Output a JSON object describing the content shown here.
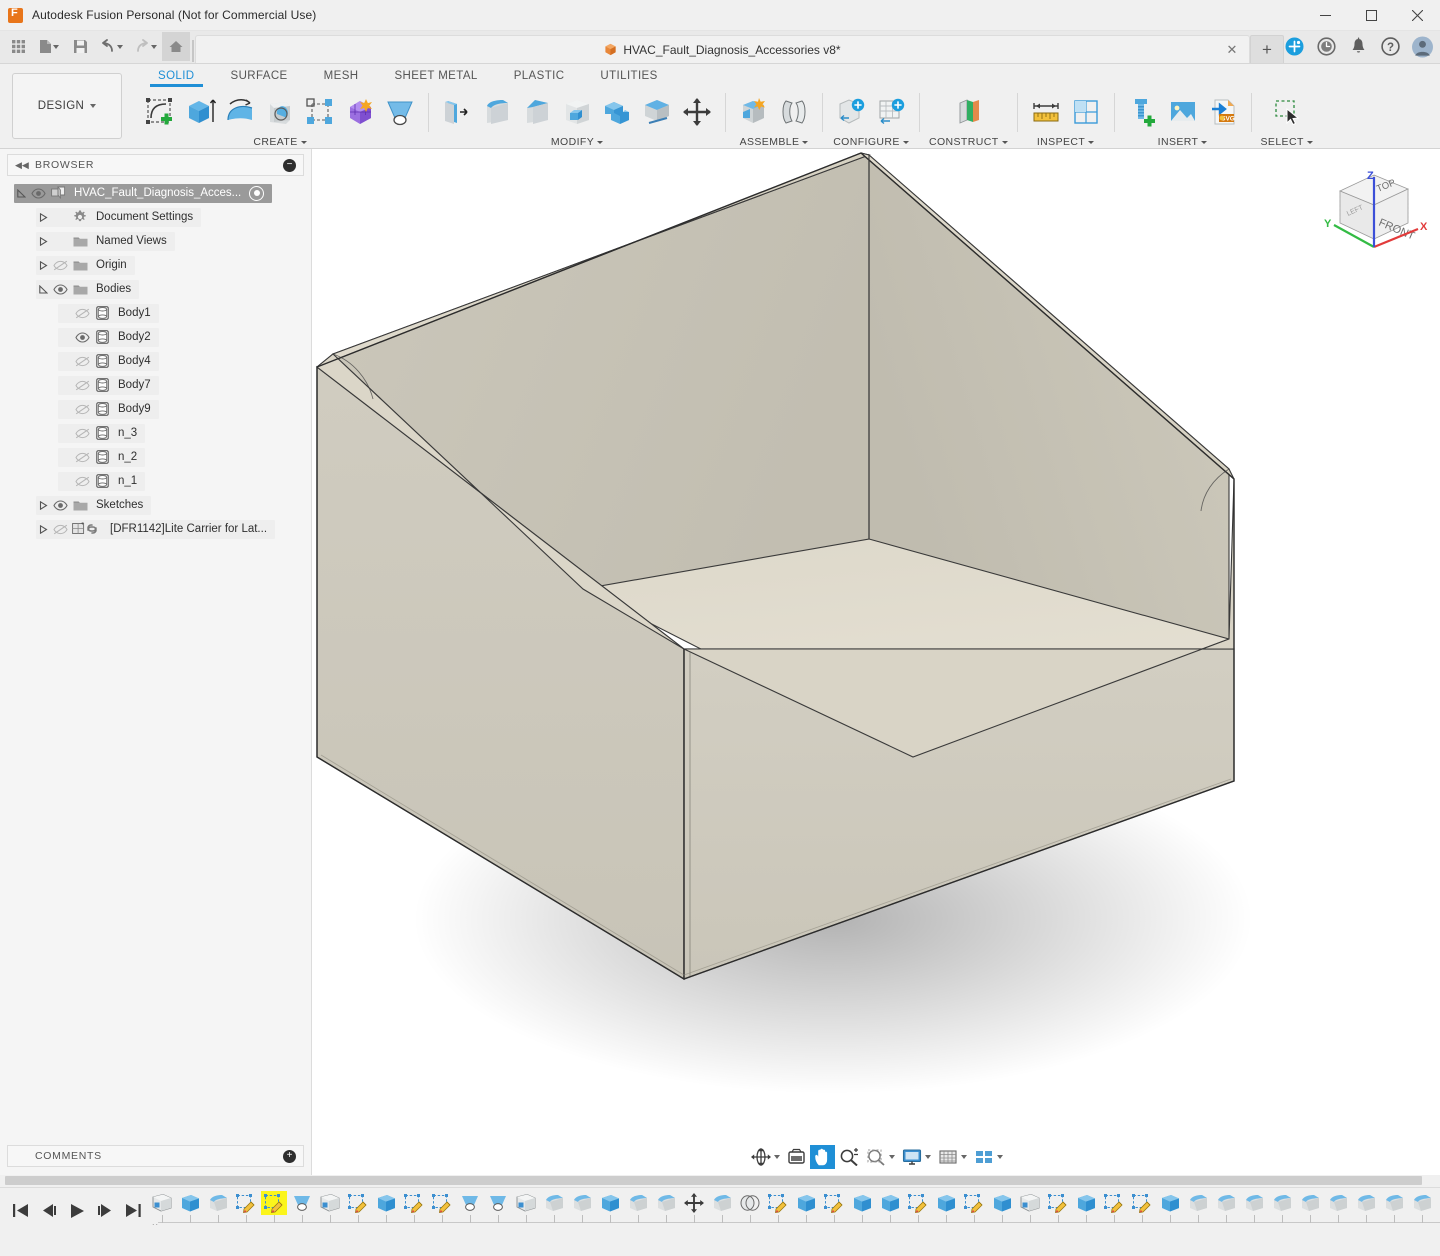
{
  "window": {
    "app_title": "Autodesk Fusion Personal (Not for Commercial Use)",
    "app_icon": "fusion-logo-icon",
    "minimize": "—",
    "maximize": "☐",
    "close": "✕"
  },
  "quick_access": {
    "items": [
      {
        "name": "app-grid-button",
        "icon": "grid-icon",
        "caret": false
      },
      {
        "name": "new-file-button",
        "icon": "file-icon",
        "caret": true
      },
      {
        "name": "save-button",
        "icon": "save-icon",
        "caret": false
      },
      {
        "name": "undo-button",
        "icon": "undo-arrow-icon",
        "caret": true
      },
      {
        "name": "redo-button",
        "icon": "redo-arrow-icon",
        "caret": true
      },
      {
        "name": "home-button",
        "icon": "home-icon",
        "caret": false
      }
    ]
  },
  "document_tab": {
    "label": "HVAC_Fault_Diagnosis_Accessories v8*",
    "icon": "orange-cube-icon",
    "close_label": "✕",
    "new_tab_label": "+"
  },
  "tab_right_icons": [
    {
      "name": "extensions-icon",
      "glyph": "+"
    },
    {
      "name": "job-status-clock-icon",
      "glyph": "○"
    },
    {
      "name": "notifications-bell-icon",
      "glyph": "🔔"
    },
    {
      "name": "help-question-icon",
      "glyph": "?"
    },
    {
      "name": "user-avatar",
      "glyph": ""
    }
  ],
  "ribbon": {
    "workspace_label": "DESIGN",
    "tabs": [
      {
        "label": "SOLID",
        "active": true
      },
      {
        "label": "SURFACE",
        "active": false
      },
      {
        "label": "MESH",
        "active": false
      },
      {
        "label": "SHEET METAL",
        "active": false
      },
      {
        "label": "PLASTIC",
        "active": false
      },
      {
        "label": "UTILITIES",
        "active": false
      }
    ],
    "panels": [
      {
        "title": "CREATE",
        "has_caret": true,
        "buttons": [
          {
            "name": "create-sketch-button",
            "icon": "new-sketch-icon"
          },
          {
            "name": "extrude-button",
            "icon": "extrude-icon"
          },
          {
            "name": "revolve-button",
            "icon": "revolve-icon"
          },
          {
            "name": "sweep-button",
            "icon": "sweep-icon"
          },
          {
            "name": "pattern-button",
            "icon": "rectangular-pattern-icon"
          },
          {
            "name": "create-form-button",
            "icon": "form-sculpt-icon"
          },
          {
            "name": "loft-button",
            "icon": "loft-icon"
          }
        ]
      },
      {
        "title": "MODIFY",
        "has_caret": true,
        "buttons": [
          {
            "name": "press-pull-button",
            "icon": "press-pull-icon"
          },
          {
            "name": "fillet-button",
            "icon": "fillet-icon"
          },
          {
            "name": "chamfer-button",
            "icon": "chamfer-icon"
          },
          {
            "name": "shell-button",
            "icon": "shell-icon"
          },
          {
            "name": "combine-button",
            "icon": "combine-icon"
          },
          {
            "name": "split-face-button",
            "icon": "split-body-icon"
          },
          {
            "name": "move-copy-button",
            "icon": "move-copy-arrows-icon"
          }
        ]
      },
      {
        "title": "ASSEMBLE",
        "has_caret": true,
        "buttons": [
          {
            "name": "new-component-button",
            "icon": "new-component-icon"
          },
          {
            "name": "joint-button",
            "icon": "joint-icon"
          }
        ]
      },
      {
        "title": "CONFIGURE",
        "has_caret": true,
        "buttons": [
          {
            "name": "configuration-button",
            "icon": "configure-part-icon"
          },
          {
            "name": "configuration-table-button",
            "icon": "configure-table-icon"
          }
        ]
      },
      {
        "title": "CONSTRUCT",
        "has_caret": true,
        "buttons": [
          {
            "name": "offset-plane-button",
            "icon": "construction-plane-icon"
          }
        ]
      },
      {
        "title": "INSPECT",
        "has_caret": true,
        "buttons": [
          {
            "name": "measure-button",
            "icon": "ruler-measure-icon"
          },
          {
            "name": "section-analysis-button",
            "icon": "section-analysis-icon"
          }
        ]
      },
      {
        "title": "INSERT",
        "has_caret": true,
        "buttons": [
          {
            "name": "insert-mcmaster-button",
            "icon": "bolt-insert-icon"
          },
          {
            "name": "canvas-insert-button",
            "icon": "picture-insert-icon"
          },
          {
            "name": "insert-svg-button",
            "icon": "svg-insert-icon"
          }
        ]
      },
      {
        "title": "SELECT",
        "has_caret": true,
        "buttons": [
          {
            "name": "select-tool-button",
            "icon": "selection-cursor-icon"
          }
        ]
      }
    ]
  },
  "browser": {
    "header": "BROWSER",
    "collapse_icon": "collapse-left-arrows-icon",
    "minus_icon": "minus-circle-icon",
    "nodes": [
      {
        "label": "HVAC_Fault_Diagnosis_Acces...",
        "indent": 0,
        "triangle": "expanded",
        "eye": "visible",
        "icon": "component-icon",
        "selected": true,
        "radio": true
      },
      {
        "label": "Document Settings",
        "indent": 1,
        "triangle": "collapsed",
        "eye": "none",
        "icon": "gear-icon",
        "selected": false,
        "radio": false
      },
      {
        "label": "Named Views",
        "indent": 1,
        "triangle": "collapsed",
        "eye": "none",
        "icon": "folder-icon",
        "selected": false,
        "radio": false
      },
      {
        "label": "Origin",
        "indent": 1,
        "triangle": "collapsed",
        "eye": "hidden",
        "icon": "folder-icon",
        "selected": false,
        "radio": false
      },
      {
        "label": "Bodies",
        "indent": 1,
        "triangle": "expanded",
        "eye": "visible",
        "icon": "folder-icon",
        "selected": false,
        "radio": false
      },
      {
        "label": "Body1",
        "indent": 2,
        "triangle": "none",
        "eye": "hidden",
        "icon": "body-icon",
        "selected": false,
        "radio": false
      },
      {
        "label": "Body2",
        "indent": 2,
        "triangle": "none",
        "eye": "visible",
        "icon": "body-icon",
        "selected": false,
        "radio": false
      },
      {
        "label": "Body4",
        "indent": 2,
        "triangle": "none",
        "eye": "hidden",
        "icon": "body-icon",
        "selected": false,
        "radio": false
      },
      {
        "label": "Body7",
        "indent": 2,
        "triangle": "none",
        "eye": "hidden",
        "icon": "body-icon",
        "selected": false,
        "radio": false
      },
      {
        "label": "Body9",
        "indent": 2,
        "triangle": "none",
        "eye": "hidden",
        "icon": "body-icon",
        "selected": false,
        "radio": false
      },
      {
        "label": "n_3",
        "indent": 2,
        "triangle": "none",
        "eye": "hidden",
        "icon": "body-icon",
        "selected": false,
        "radio": false
      },
      {
        "label": "n_2",
        "indent": 2,
        "triangle": "none",
        "eye": "hidden",
        "icon": "body-icon",
        "selected": false,
        "radio": false
      },
      {
        "label": "n_1",
        "indent": 2,
        "triangle": "none",
        "eye": "hidden",
        "icon": "body-icon",
        "selected": false,
        "radio": false
      },
      {
        "label": "Sketches",
        "indent": 1,
        "triangle": "collapsed",
        "eye": "visible",
        "icon": "folder-icon",
        "selected": false,
        "radio": false
      },
      {
        "label": "[DFR1142]Lite Carrier for Lat...",
        "indent": 1,
        "triangle": "collapsed",
        "eye": "hidden",
        "icon": "linked-component-icon",
        "selected": false,
        "radio": false
      }
    ]
  },
  "comments": {
    "header": "COMMENTS",
    "add_icon": "plus-circle-icon"
  },
  "viewcube": {
    "top_label": "TOP",
    "front_label": "FRONT",
    "left_label": "LEFT",
    "axis_x": "X",
    "axis_y": "Y",
    "axis_z": "Z",
    "color_x": "#e23b3b",
    "color_y": "#33bb44",
    "color_z": "#3c4fd8"
  },
  "navigation_bar": {
    "items": [
      {
        "name": "orbit-button",
        "icon": "orbit-icon",
        "caret": true,
        "active": false
      },
      {
        "name": "look-at-button",
        "icon": "look-at-icon",
        "caret": false,
        "active": false
      },
      {
        "name": "pan-button",
        "icon": "pan-hand-icon",
        "caret": false,
        "active": true
      },
      {
        "name": "zoom-button",
        "icon": "zoom-magnifier-icon",
        "caret": false,
        "active": false
      },
      {
        "name": "fit-button",
        "icon": "zoom-fit-icon",
        "caret": true,
        "active": false
      },
      {
        "name": "display-settings-button",
        "icon": "monitor-display-icon",
        "caret": true,
        "active": false
      },
      {
        "name": "grid-snaps-button",
        "icon": "grid-snap-icon",
        "caret": true,
        "active": false
      },
      {
        "name": "viewports-button",
        "icon": "viewport-layout-icon",
        "caret": true,
        "active": false
      }
    ]
  },
  "timeline": {
    "playback": [
      {
        "name": "timeline-go-start-button",
        "icon": "skip-to-start-icon"
      },
      {
        "name": "timeline-step-back-button",
        "icon": "step-back-icon"
      },
      {
        "name": "timeline-play-button",
        "icon": "play-icon"
      },
      {
        "name": "timeline-step-forward-button",
        "icon": "step-forward-icon"
      },
      {
        "name": "timeline-go-end-button",
        "icon": "skip-to-end-icon"
      }
    ],
    "settings_icon": "gear-icon",
    "playhead_icon": "timeline-marker-icon",
    "features": [
      {
        "icon": "sketch-plane-icon",
        "highlight": false
      },
      {
        "icon": "extrude-icon",
        "highlight": false
      },
      {
        "icon": "fillet-icon",
        "highlight": false
      },
      {
        "icon": "sketch-edit-icon",
        "highlight": false
      },
      {
        "icon": "sketch-edit-icon",
        "highlight": true
      },
      {
        "icon": "revolve-icon",
        "highlight": false
      },
      {
        "icon": "sketch-plane-icon",
        "highlight": false
      },
      {
        "icon": "sketch-edit-icon",
        "highlight": false
      },
      {
        "icon": "extrude-icon",
        "highlight": false
      },
      {
        "icon": "sketch-edit-icon",
        "highlight": false
      },
      {
        "icon": "sketch-edit-icon",
        "highlight": false
      },
      {
        "icon": "revolve-icon",
        "highlight": false
      },
      {
        "icon": "revolve-icon",
        "highlight": false
      },
      {
        "icon": "sketch-plane-icon",
        "highlight": false
      },
      {
        "icon": "fillet-icon",
        "highlight": false
      },
      {
        "icon": "fillet-icon",
        "highlight": false
      },
      {
        "icon": "extrude-icon",
        "highlight": false
      },
      {
        "icon": "fillet-icon",
        "highlight": false
      },
      {
        "icon": "fillet-icon",
        "highlight": false
      },
      {
        "icon": "move-copy-arrows-icon",
        "highlight": false
      },
      {
        "icon": "fillet-icon",
        "highlight": false
      },
      {
        "icon": "combine-icon",
        "highlight": false
      },
      {
        "icon": "sketch-edit-icon",
        "highlight": false
      },
      {
        "icon": "extrude-icon",
        "highlight": false
      },
      {
        "icon": "sketch-edit-icon",
        "highlight": false
      },
      {
        "icon": "extrude-icon",
        "highlight": false
      },
      {
        "icon": "extrude-icon",
        "highlight": false
      },
      {
        "icon": "sketch-edit-icon",
        "highlight": false
      },
      {
        "icon": "extrude-icon",
        "highlight": false
      },
      {
        "icon": "sketch-edit-icon",
        "highlight": false
      },
      {
        "icon": "extrude-icon",
        "highlight": false
      },
      {
        "icon": "sketch-plane-icon",
        "highlight": false
      },
      {
        "icon": "sketch-edit-icon",
        "highlight": false
      },
      {
        "icon": "extrude-icon",
        "highlight": false
      },
      {
        "icon": "sketch-edit-icon",
        "highlight": false
      },
      {
        "icon": "sketch-edit-icon",
        "highlight": false
      },
      {
        "icon": "extrude-icon",
        "highlight": false
      },
      {
        "icon": "fillet-icon",
        "highlight": false
      },
      {
        "icon": "fillet-icon",
        "highlight": false
      },
      {
        "icon": "fillet-icon",
        "highlight": false
      },
      {
        "icon": "fillet-icon",
        "highlight": false
      },
      {
        "icon": "fillet-icon",
        "highlight": false
      },
      {
        "icon": "fillet-icon",
        "highlight": false
      },
      {
        "icon": "fillet-icon",
        "highlight": false
      },
      {
        "icon": "fillet-icon",
        "highlight": false
      },
      {
        "icon": "fillet-icon",
        "highlight": false
      },
      {
        "icon": "move-copy-arrows-icon",
        "highlight": false
      },
      {
        "icon": "move-copy-arrows-icon",
        "highlight": false
      },
      {
        "icon": "sketch-edit-icon",
        "highlight": false
      },
      {
        "icon": "extrude-icon",
        "highlight": false
      },
      {
        "icon": "sketch-edit-icon",
        "highlight": false
      },
      {
        "icon": "extrude-icon",
        "highlight": false
      }
    ]
  },
  "model": {
    "description": "open-top rectangular tray solid body",
    "face_front_left_color": "#ccc8bc",
    "face_front_right_color": "#cdc9bd",
    "face_inner_bottom_color": "#e3ded1",
    "face_inner_wall_color": "#c9c5b8",
    "rim_color": "#ddd8c9",
    "edge_color": "#3a3a3a",
    "background_color": "#ffffff"
  }
}
